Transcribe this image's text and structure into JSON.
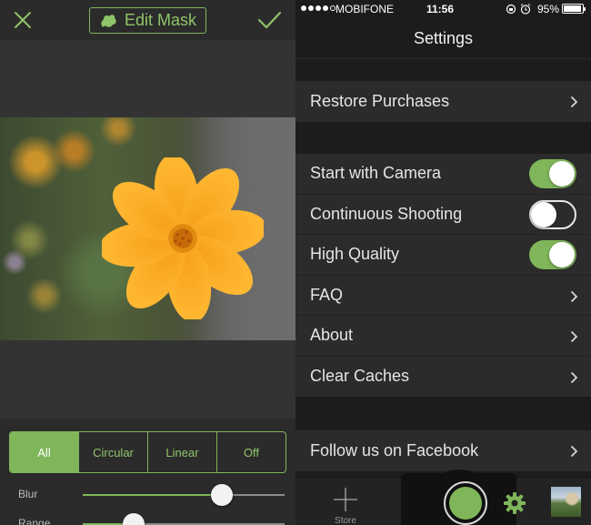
{
  "editor": {
    "title": "Edit Mask",
    "close_icon": "close-x-icon",
    "confirm_icon": "checkmark-icon",
    "accent_color": "#7fb65a",
    "mask_modes": [
      "All",
      "Circular",
      "Linear",
      "Off"
    ],
    "active_mode": "All",
    "sliders": [
      {
        "label": "Blur",
        "value_fraction": 0.69
      },
      {
        "label": "Range",
        "value_fraction": 0.25
      }
    ]
  },
  "status_bar": {
    "carrier": "MOBIFONE",
    "time": "11:56",
    "battery": "95%",
    "battery_level": 0.95
  },
  "settings": {
    "title": "Settings",
    "group1": [
      {
        "label": "Restore Purchases",
        "type": "chevron"
      }
    ],
    "group2": [
      {
        "label": "Start with Camera",
        "type": "toggle",
        "on": true
      },
      {
        "label": "Continuous Shooting",
        "type": "toggle",
        "on": false
      },
      {
        "label": "High Quality",
        "type": "toggle",
        "on": true
      },
      {
        "label": "FAQ",
        "type": "chevron"
      },
      {
        "label": "About",
        "type": "chevron"
      },
      {
        "label": "Clear Caches",
        "type": "chevron"
      }
    ],
    "group3": [
      {
        "label": "Follow us on Facebook",
        "type": "chevron"
      }
    ]
  },
  "tabbar": {
    "store_label": "Store",
    "store_icon": "plus-icon",
    "settings_icon": "gear-icon"
  }
}
